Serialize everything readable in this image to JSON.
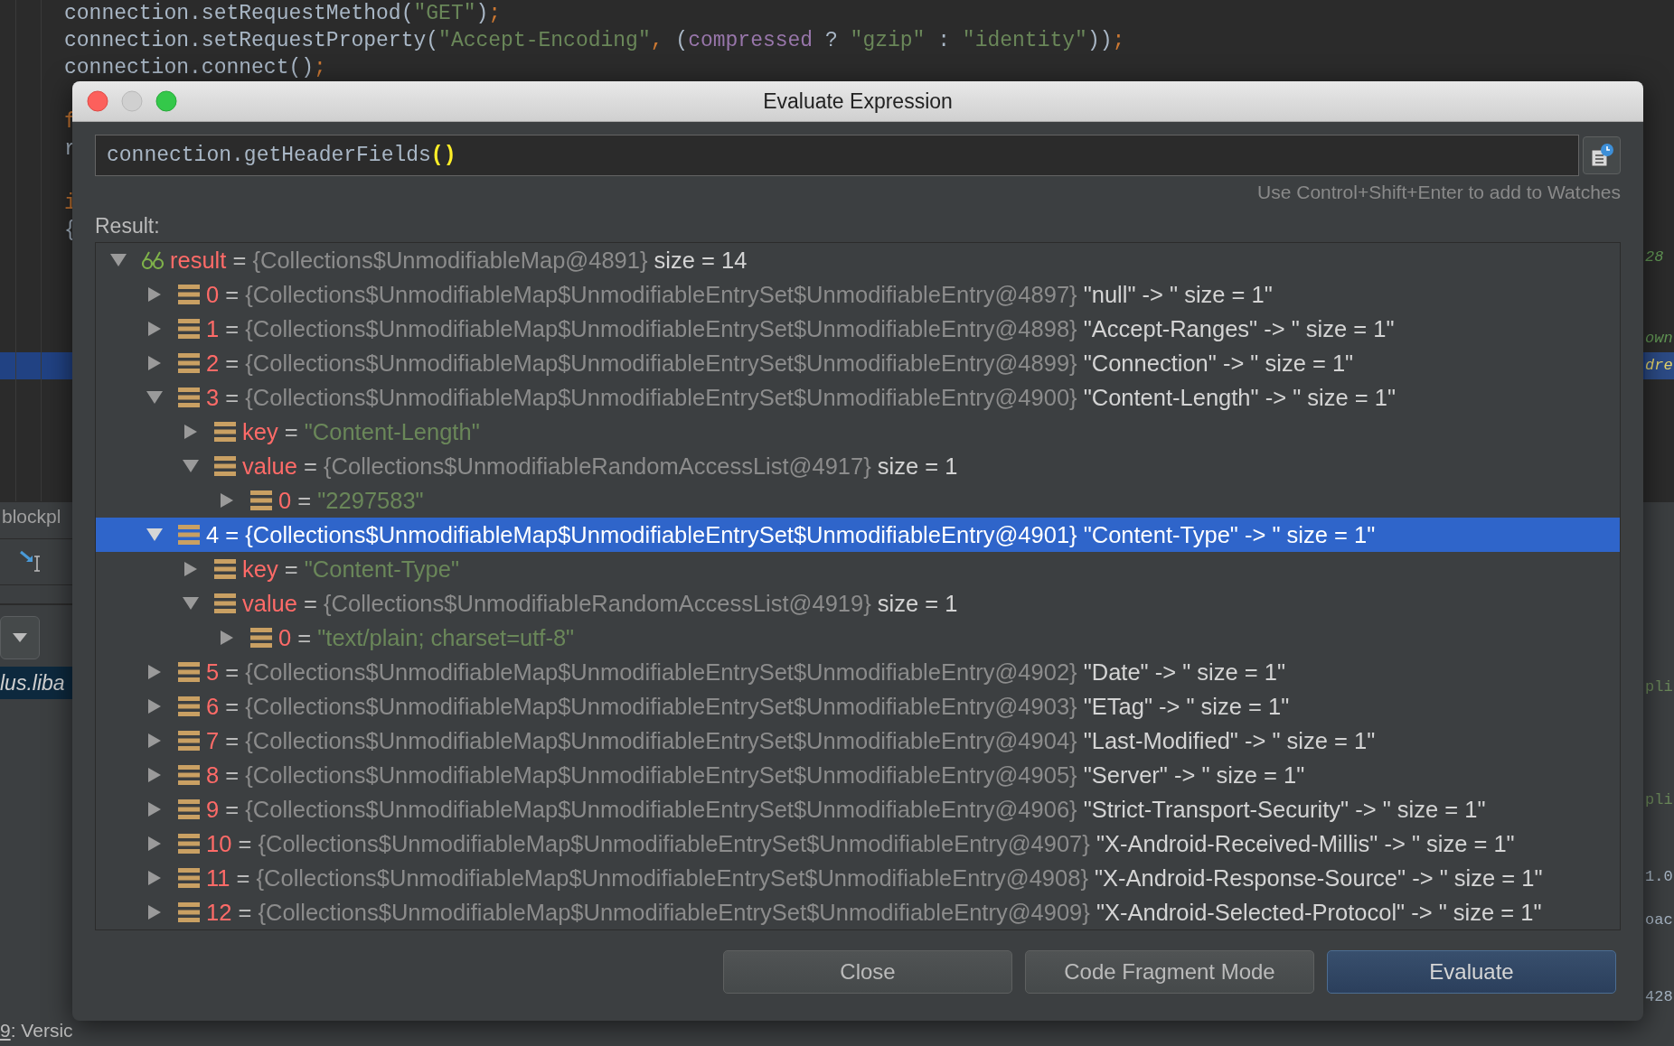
{
  "editor": {
    "lines": [
      {
        "highlighted": false,
        "tokens": [
          {
            "text": "connection.setRequestMethod(",
            "kind": "plain"
          },
          {
            "text": "\"GET\"",
            "kind": "string"
          },
          {
            "text": ")",
            "kind": "plain"
          },
          {
            "text": ";",
            "kind": "punct"
          }
        ]
      },
      {
        "highlighted": false,
        "tokens": [
          {
            "text": "connection.setRequestProperty(",
            "kind": "plain"
          },
          {
            "text": "\"Accept-Encoding\"",
            "kind": "string"
          },
          {
            "text": ",",
            "kind": "punct"
          },
          {
            "text": " (",
            "kind": "plain"
          },
          {
            "text": "compressed",
            "kind": "field"
          },
          {
            "text": " ? ",
            "kind": "plain"
          },
          {
            "text": "\"gzip\"",
            "kind": "string"
          },
          {
            "text": " : ",
            "kind": "plain"
          },
          {
            "text": "\"identity\"",
            "kind": "string"
          },
          {
            "text": "))",
            "kind": "plain"
          },
          {
            "text": ";",
            "kind": "punct"
          }
        ]
      },
      {
        "highlighted": false,
        "tokens": [
          {
            "text": "connection.connect()",
            "kind": "plain"
          },
          {
            "text": ";",
            "kind": "punct"
          }
        ]
      },
      {
        "highlighted": false
      },
      {
        "highlighted": false,
        "tokens": [
          {
            "text": "f",
            "kind": "keyword"
          }
        ]
      },
      {
        "highlighted": false,
        "tokens": [
          {
            "text": "r",
            "kind": "plain"
          }
        ]
      },
      {
        "highlighted": false
      },
      {
        "highlighted": false,
        "tokens": [
          {
            "text": "i",
            "kind": "keyword"
          }
        ]
      },
      {
        "highlighted": false,
        "tokens": [
          {
            "text": "{",
            "kind": "plain"
          }
        ]
      },
      {
        "highlighted": false,
        "tail": {
          "text": "28",
          "kind": "doc"
        }
      },
      {
        "highlighted": false
      },
      {
        "highlighted": false
      },
      {
        "highlighted": false,
        "tail": {
          "text": "own",
          "kind": "doc"
        }
      },
      {
        "highlighted": true,
        "tail": {
          "text": "dre",
          "kind": "match"
        }
      },
      {
        "highlighted": false
      },
      {
        "highlighted": false
      },
      {
        "highlighted": false
      },
      {
        "highlighted": false
      }
    ]
  },
  "bottom_panel": {
    "tab_label": "blockpl",
    "selected_item": "lus.liba",
    "status_tool": {
      "mnemonic": "9",
      "label": ": Versic"
    },
    "right_fragments": [
      {
        "text": "pli",
        "kind": "string"
      },
      {
        "text": "pli",
        "kind": "string"
      },
      {
        "text": "1.0",
        "kind": "plain"
      },
      {
        "text": "oac",
        "kind": "plain"
      },
      {
        "text": "428",
        "kind": "plain"
      }
    ]
  },
  "dialog": {
    "title": "Evaluate Expression",
    "expression": {
      "code": "connection.getHeaderFields",
      "parens": "()"
    },
    "hint": "Use Control+Shift+Enter to add to Watches",
    "result_label": "Result:",
    "tree": [
      {
        "kind": "watch",
        "name": "result",
        "op": "=",
        "type": "{Collections$UnmodifiableMap@4891}",
        "summary": "size = 14",
        "expanded": true,
        "selected": false,
        "children": [
          {
            "kind": "entry",
            "name": "0",
            "op": "=",
            "type": "{Collections$UnmodifiableMap$UnmodifiableEntrySet$UnmodifiableEntry@4897}",
            "summary": "\"null\" -> \" size = 1\"",
            "expanded": false,
            "selected": false
          },
          {
            "kind": "entry",
            "name": "1",
            "op": "=",
            "type": "{Collections$UnmodifiableMap$UnmodifiableEntrySet$UnmodifiableEntry@4898}",
            "summary": "\"Accept-Ranges\" -> \" size = 1\"",
            "expanded": false,
            "selected": false
          },
          {
            "kind": "entry",
            "name": "2",
            "op": "=",
            "type": "{Collections$UnmodifiableMap$UnmodifiableEntrySet$UnmodifiableEntry@4899}",
            "summary": "\"Connection\" -> \" size = 1\"",
            "expanded": false,
            "selected": false
          },
          {
            "kind": "entry",
            "name": "3",
            "op": "=",
            "type": "{Collections$UnmodifiableMap$UnmodifiableEntrySet$UnmodifiableEntry@4900}",
            "summary": "\"Content-Length\" -> \" size = 1\"",
            "expanded": true,
            "selected": false,
            "children": [
              {
                "kind": "entry",
                "name": "key",
                "op": "=",
                "value": "\"Content-Length\"",
                "expanded": false,
                "selected": false
              },
              {
                "kind": "entry",
                "name": "value",
                "op": "=",
                "type": "{Collections$UnmodifiableRandomAccessList@4917}",
                "summary": "size = 1",
                "expanded": true,
                "selected": false,
                "children": [
                  {
                    "kind": "entry",
                    "name": "0",
                    "op": "=",
                    "value": "\"2297583\"",
                    "expanded": false,
                    "selected": false
                  }
                ]
              }
            ]
          },
          {
            "kind": "entry",
            "name": "4",
            "op": "=",
            "type": "{Collections$UnmodifiableMap$UnmodifiableEntrySet$UnmodifiableEntry@4901}",
            "summary": "\"Content-Type\" -> \" size = 1\"",
            "expanded": true,
            "selected": true,
            "children": [
              {
                "kind": "entry",
                "name": "key",
                "op": "=",
                "value": "\"Content-Type\"",
                "expanded": false,
                "selected": false
              },
              {
                "kind": "entry",
                "name": "value",
                "op": "=",
                "type": "{Collections$UnmodifiableRandomAccessList@4919}",
                "summary": "size = 1",
                "expanded": true,
                "selected": false,
                "children": [
                  {
                    "kind": "entry",
                    "name": "0",
                    "op": "=",
                    "value": "\"text/plain; charset=utf-8\"",
                    "expanded": false,
                    "selected": false
                  }
                ]
              }
            ]
          },
          {
            "kind": "entry",
            "name": "5",
            "op": "=",
            "type": "{Collections$UnmodifiableMap$UnmodifiableEntrySet$UnmodifiableEntry@4902}",
            "summary": "\"Date\" -> \" size = 1\"",
            "expanded": false,
            "selected": false
          },
          {
            "kind": "entry",
            "name": "6",
            "op": "=",
            "type": "{Collections$UnmodifiableMap$UnmodifiableEntrySet$UnmodifiableEntry@4903}",
            "summary": "\"ETag\" -> \" size = 1\"",
            "expanded": false,
            "selected": false
          },
          {
            "kind": "entry",
            "name": "7",
            "op": "=",
            "type": "{Collections$UnmodifiableMap$UnmodifiableEntrySet$UnmodifiableEntry@4904}",
            "summary": "\"Last-Modified\" -> \" size = 1\"",
            "expanded": false,
            "selected": false
          },
          {
            "kind": "entry",
            "name": "8",
            "op": "=",
            "type": "{Collections$UnmodifiableMap$UnmodifiableEntrySet$UnmodifiableEntry@4905}",
            "summary": "\"Server\" -> \" size = 1\"",
            "expanded": false,
            "selected": false
          },
          {
            "kind": "entry",
            "name": "9",
            "op": "=",
            "type": "{Collections$UnmodifiableMap$UnmodifiableEntrySet$UnmodifiableEntry@4906}",
            "summary": "\"Strict-Transport-Security\" -> \" size = 1\"",
            "expanded": false,
            "selected": false
          },
          {
            "kind": "entry",
            "name": "10",
            "op": "=",
            "type": "{Collections$UnmodifiableMap$UnmodifiableEntrySet$UnmodifiableEntry@4907}",
            "summary": "\"X-Android-Received-Millis\" -> \" size = 1\"",
            "expanded": false,
            "selected": false
          },
          {
            "kind": "entry",
            "name": "11",
            "op": "=",
            "type": "{Collections$UnmodifiableMap$UnmodifiableEntrySet$UnmodifiableEntry@4908}",
            "summary": "\"X-Android-Response-Source\" -> \" size = 1\"",
            "expanded": false,
            "selected": false
          },
          {
            "kind": "entry",
            "name": "12",
            "op": "=",
            "type": "{Collections$UnmodifiableMap$UnmodifiableEntrySet$UnmodifiableEntry@4909}",
            "summary": "\"X-Android-Selected-Protocol\" -> \" size = 1\"",
            "expanded": false,
            "selected": false
          }
        ]
      }
    ],
    "buttons": [
      {
        "label": "Close",
        "default": false
      },
      {
        "label": "Code Fragment Mode",
        "default": false
      },
      {
        "label": "Evaluate",
        "default": true
      }
    ]
  }
}
